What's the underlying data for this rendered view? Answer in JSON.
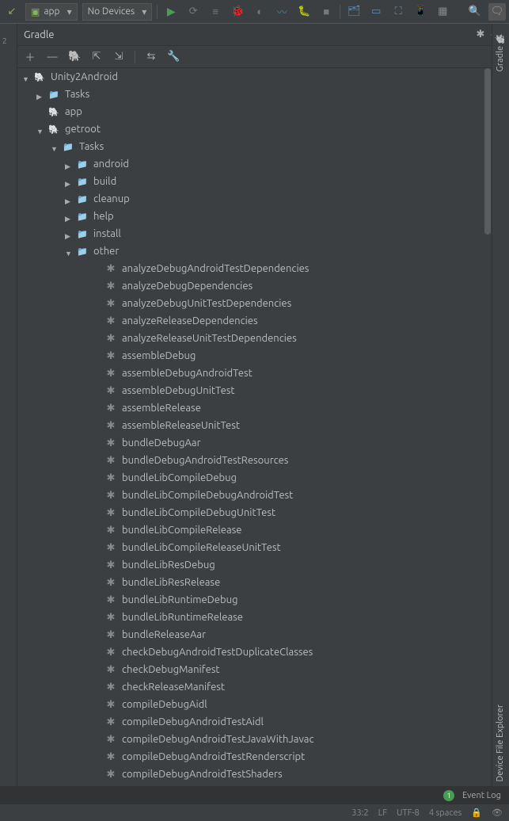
{
  "toolbar": {
    "module_label": "app",
    "device_label": "No Devices"
  },
  "panel": {
    "title": "Gradle"
  },
  "rightTabs": {
    "gradle": "Gradle",
    "explorer": "Device File Explorer"
  },
  "tree": {
    "root": "Unity2Android",
    "tasks": "Tasks",
    "app": "app",
    "getroot": "getroot",
    "tasks2": "Tasks",
    "folders": [
      {
        "label": "android"
      },
      {
        "label": "build"
      },
      {
        "label": "cleanup"
      },
      {
        "label": "help"
      },
      {
        "label": "install"
      },
      {
        "label": "other",
        "open": true
      }
    ],
    "otherTasks": [
      "analyzeDebugAndroidTestDependencies",
      "analyzeDebugDependencies",
      "analyzeDebugUnitTestDependencies",
      "analyzeReleaseDependencies",
      "analyzeReleaseUnitTestDependencies",
      "assembleDebug",
      "assembleDebugAndroidTest",
      "assembleDebugUnitTest",
      "assembleRelease",
      "assembleReleaseUnitTest",
      "bundleDebugAar",
      "bundleDebugAndroidTestResources",
      "bundleLibCompileDebug",
      "bundleLibCompileDebugAndroidTest",
      "bundleLibCompileDebugUnitTest",
      "bundleLibCompileRelease",
      "bundleLibCompileReleaseUnitTest",
      "bundleLibResDebug",
      "bundleLibResRelease",
      "bundleLibRuntimeDebug",
      "bundleLibRuntimeRelease",
      "bundleReleaseAar",
      "checkDebugAndroidTestDuplicateClasses",
      "checkDebugManifest",
      "checkReleaseManifest",
      "compileDebugAidl",
      "compileDebugAndroidTestAidl",
      "compileDebugAndroidTestJavaWithJavac",
      "compileDebugAndroidTestRenderscript",
      "compileDebugAndroidTestShaders"
    ]
  },
  "eventlog": {
    "label": "Event Log",
    "count": "1"
  },
  "status": {
    "pos": "33:2",
    "sep": "LF",
    "enc": "UTF-8",
    "indent": "4 spaces"
  },
  "gutterNum": "2"
}
